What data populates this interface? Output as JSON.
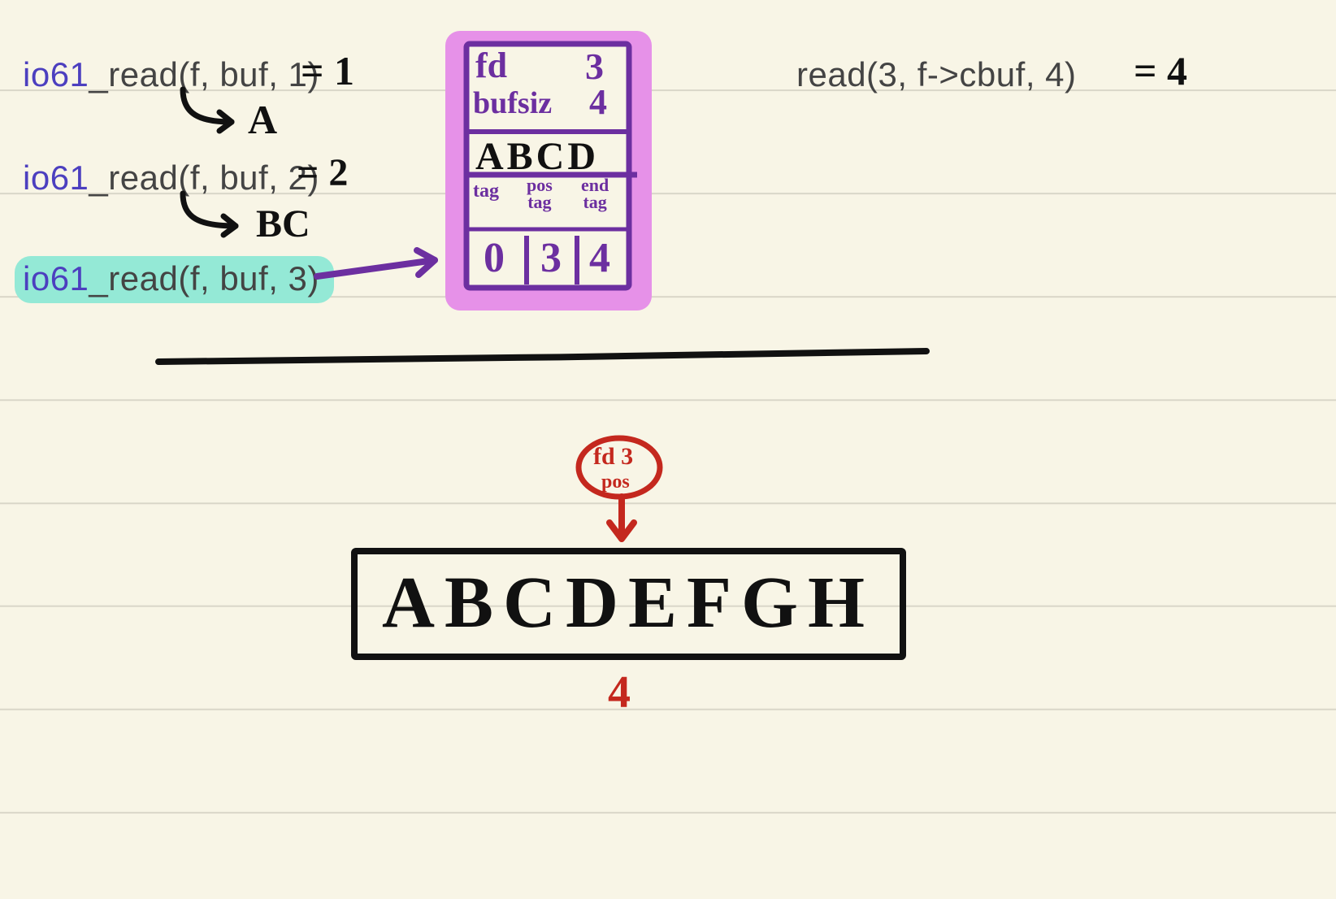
{
  "calls": {
    "c1": {
      "fn": "io61",
      "label": "_read(f, buf, 1)",
      "result": "= 1",
      "output": "A"
    },
    "c2": {
      "fn": "io61",
      "label": "_read(f, buf, 2)",
      "result": "= 2",
      "output": "BC"
    },
    "c3": {
      "fn": "io61",
      "label": "_read(f, buf, 3)"
    }
  },
  "syscall": {
    "label": "read(3, f->cbuf, 4)",
    "result": "= 4"
  },
  "struct": {
    "row1": {
      "k1": "fd",
      "v1": "3"
    },
    "row2": {
      "k2": "bufsiz",
      "v2": "4"
    },
    "buf": "ABCD",
    "hdr": {
      "a": "tag",
      "b": "pos_tag",
      "c": "end_tag"
    },
    "vals": {
      "a": "0",
      "b": "3",
      "c": "4"
    }
  },
  "file": {
    "badge": "fd 3",
    "badge2": "pos",
    "content": "ABCDEFGH",
    "pointer_value": "4"
  }
}
